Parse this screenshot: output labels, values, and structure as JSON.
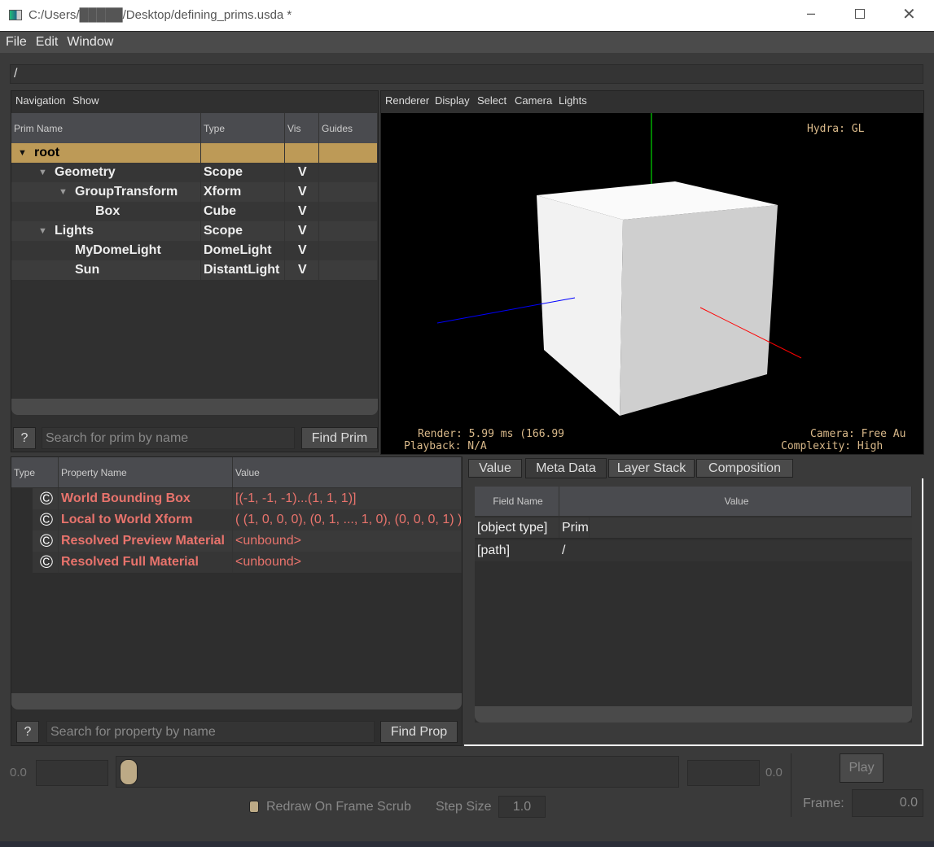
{
  "window": {
    "title": "C:/Users/█████/Desktop/defining_prims.usda *",
    "controls": [
      "minimize",
      "maximize",
      "close"
    ]
  },
  "menubar": [
    "File",
    "Edit",
    "Window"
  ],
  "path_field": "/",
  "prim_panel": {
    "menus": [
      "Navigation",
      "Show"
    ],
    "columns": [
      "Prim Name",
      "Type",
      "Vis",
      "Guides"
    ],
    "rows": [
      {
        "name": "root",
        "type": "",
        "vis": "",
        "depth": 0,
        "expanded": true,
        "selected": true
      },
      {
        "name": "Geometry",
        "type": "Scope",
        "vis": "V",
        "depth": 1,
        "expanded": true
      },
      {
        "name": "GroupTransform",
        "type": "Xform",
        "vis": "V",
        "depth": 2,
        "expanded": true
      },
      {
        "name": "Box",
        "type": "Cube",
        "vis": "V",
        "depth": 3
      },
      {
        "name": "Lights",
        "type": "Scope",
        "vis": "V",
        "depth": 1,
        "expanded": true
      },
      {
        "name": "MyDomeLight",
        "type": "DomeLight",
        "vis": "V",
        "depth": 2
      },
      {
        "name": "Sun",
        "type": "DistantLight",
        "vis": "V",
        "depth": 2
      }
    ],
    "help": "?",
    "search_placeholder": "Search for prim by name",
    "find": "Find Prim"
  },
  "viewport": {
    "menus": [
      "Renderer",
      "Display",
      "Select",
      "Camera",
      "Lights"
    ],
    "renderer": "Hydra: GL",
    "render": "Render: 5.99 ms (166.99",
    "playback": "Playback: N/A",
    "camera": "Camera: Free Au",
    "complexity": "Complexity: High"
  },
  "property_panel": {
    "columns": [
      "Type",
      "Property Name",
      "Value"
    ],
    "rows": [
      {
        "icon": "©",
        "name": "World Bounding Box",
        "value": "[(-1, -1, -1)...(1, 1, 1)]"
      },
      {
        "icon": "©",
        "name": "Local to World Xform",
        "value": "( (1, 0, 0, 0), (0, 1, ..., 1, 0), (0, 0, 0, 1) )"
      },
      {
        "icon": "©",
        "name": "Resolved Preview Material",
        "value": "<unbound>"
      },
      {
        "icon": "©",
        "name": "Resolved Full Material",
        "value": "<unbound>"
      }
    ],
    "help": "?",
    "search_placeholder": "Search for property by name",
    "find": "Find Prop"
  },
  "inspector": {
    "tabs": [
      "Value",
      "Meta Data",
      "Layer Stack",
      "Composition"
    ],
    "active_tab": "Meta Data",
    "columns": [
      "Field Name",
      "Value"
    ],
    "rows": [
      {
        "field": "[object type]",
        "value": "Prim"
      },
      {
        "field": "[path]",
        "value": "/"
      }
    ]
  },
  "timeline": {
    "start": "0.0",
    "end": "0.0",
    "slider_fraction": 0,
    "redraw_label": "Redraw On Frame Scrub",
    "step_label": "Step Size",
    "step": "1.0",
    "play": "Play",
    "frame_label": "Frame:",
    "frame": "0.0"
  },
  "colors": {
    "selection": "#bd9a57",
    "property_text": "#e8736c",
    "axis_x": "#ff0000",
    "axis_y": "#00ff00",
    "axis_z": "#0000ff"
  }
}
